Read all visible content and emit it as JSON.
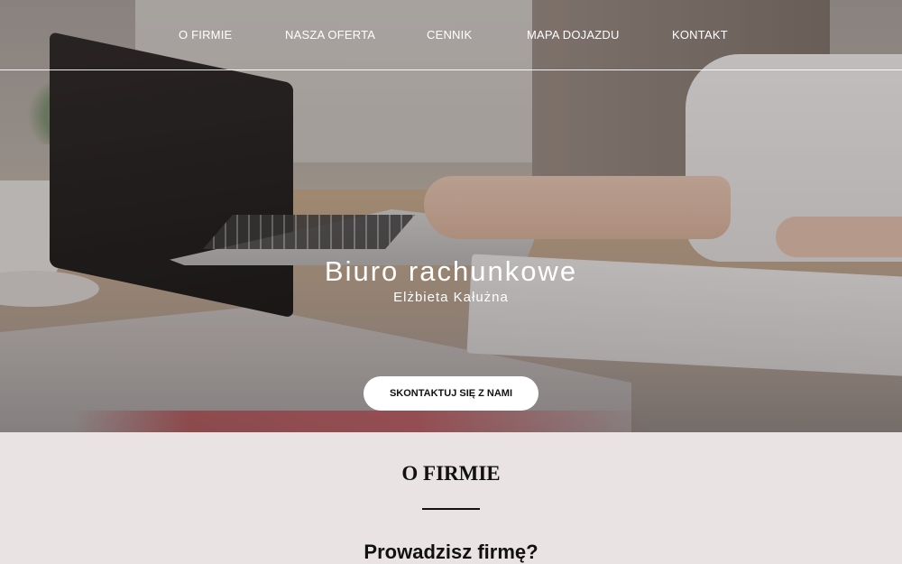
{
  "nav": {
    "items": [
      {
        "label": "O FIRMIE"
      },
      {
        "label": "NASZA OFERTA"
      },
      {
        "label": "CENNIK"
      },
      {
        "label": "MAPA DOJAZDU"
      },
      {
        "label": "KONTAKT"
      }
    ]
  },
  "hero": {
    "title": "Biuro rachunkowe",
    "subtitle": "Elżbieta Kałużna",
    "cta_label": "SKONTAKTUJ SIĘ Z NAMI",
    "image": "office-desk-laptop-photo"
  },
  "about": {
    "title": "O FIRMIE",
    "heading": "Prowadzisz firmę?"
  },
  "colors": {
    "section_background": "#e9e3e3",
    "text": "#111111",
    "nav_text": "#ffffff"
  }
}
